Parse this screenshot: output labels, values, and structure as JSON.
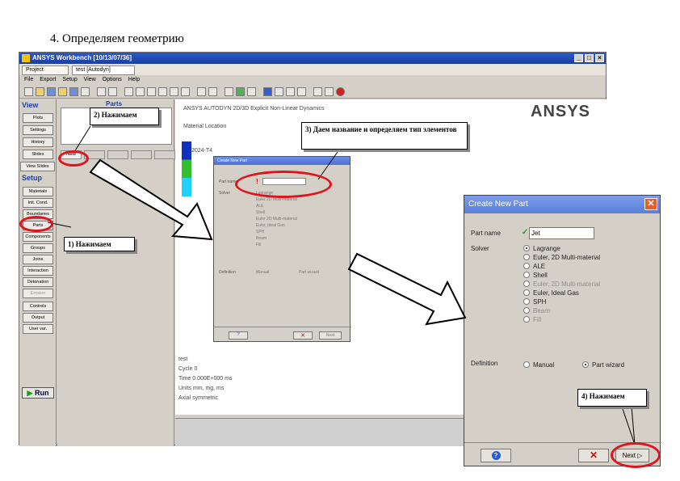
{
  "slide_title": "4. Определяем геометрию",
  "window": {
    "title": "ANSYS Workbench [10/13/07/36]",
    "tabs": [
      "Project",
      "test [Autodyn]"
    ],
    "menu": [
      "File",
      "Export",
      "Setup",
      "View",
      "Options",
      "Help"
    ]
  },
  "left_panel": {
    "view_header": "View",
    "view_buttons": [
      "Plots",
      "Settings",
      "History",
      "Slides"
    ],
    "view_slides": "View Slides",
    "setup_header": "Setup",
    "setup_buttons": [
      "Materials",
      "Init. Cond.",
      "Boundaries",
      "Parts",
      "Components",
      "Groups",
      "Joins",
      "Interaction",
      "Detonation",
      "Erosion",
      "Controls",
      "Output",
      "User var."
    ],
    "run": "Run"
  },
  "mid_panel": {
    "header": "Parts",
    "new_button": "New"
  },
  "viewport": {
    "header": "ANSYS AUTODYN 2D/3D Explicit Non-Linear Dynamics",
    "material_location": "Material Location",
    "legend_1": "2024-T4",
    "info_lines": [
      "test",
      "Cycle 0",
      "Time 0.000E+000 ms",
      "Units mm, mg, ms",
      "Axial symmetric"
    ],
    "logo": "ANSYS"
  },
  "small_dialog": {
    "title": "Create New Part",
    "part_name_label": "Part name",
    "solver_label": "Solver",
    "definition_label": "Definition",
    "solvers": [
      "Lagrange",
      "Euler 2D Multi-material",
      "ALE",
      "Shell",
      "Euler 2D Multi-material",
      "Euler, Ideal Gas",
      "SPH",
      "Beam",
      "Fill"
    ],
    "manual": "Manual",
    "part_wizard": "Part wizard",
    "next": "Next"
  },
  "big_dialog": {
    "title": "Create New Part",
    "part_name_label": "Part name",
    "part_name_value": "Jet",
    "solver_label": "Solver",
    "solvers": [
      {
        "label": "Lagrange",
        "selected": true,
        "disabled": false
      },
      {
        "label": "Euler, 2D Multi-material",
        "selected": false,
        "disabled": false
      },
      {
        "label": "ALE",
        "selected": false,
        "disabled": false
      },
      {
        "label": "Shell",
        "selected": false,
        "disabled": false
      },
      {
        "label": "Euler, 2D Multi-material",
        "selected": false,
        "disabled": true
      },
      {
        "label": "Euler, Ideal Gas",
        "selected": false,
        "disabled": false
      },
      {
        "label": "SPH",
        "selected": false,
        "disabled": false
      },
      {
        "label": "Beam",
        "selected": false,
        "disabled": true
      },
      {
        "label": "Fill",
        "selected": false,
        "disabled": true
      }
    ],
    "definition_label": "Definition",
    "manual": "Manual",
    "part_wizard": "Part wizard",
    "next": "Next",
    "help_icon": "question-icon",
    "cancel_icon": "cross-icon"
  },
  "callouts": {
    "c1": "1) Нажимаем",
    "c2": "2) Нажимаем",
    "c3": "3) Даем название и определяем тип элементов",
    "c4": "4) Нажимаем"
  },
  "colors": {
    "highlight": "#e0141c",
    "title_blue": "#1a3fa0",
    "dialog_blue": "#5a7fda"
  }
}
